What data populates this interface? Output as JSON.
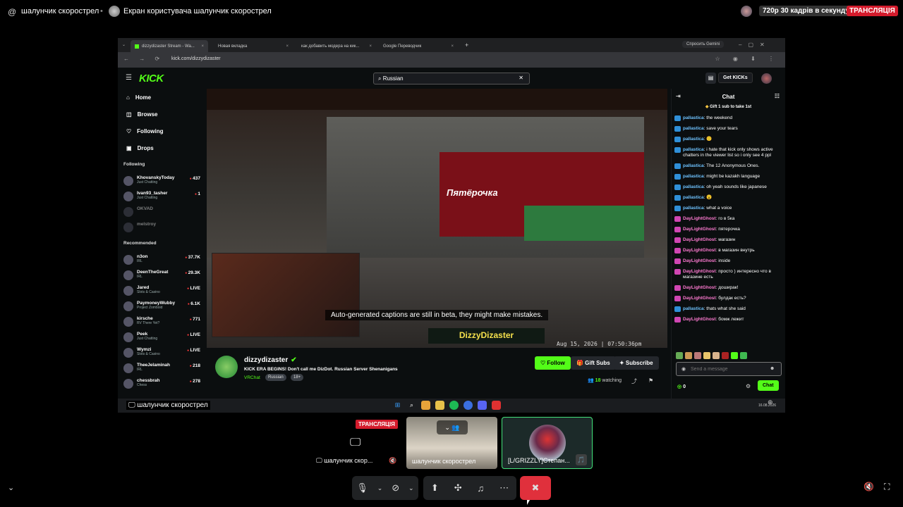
{
  "top": {
    "at_symbol": "@",
    "channel": "шалунчик скорострел",
    "screen_title": "Екран користувача шалунчик скорострел",
    "quality": "720p 30 кадрів в секунду",
    "live": "ТРАНСЛЯЦІЯ"
  },
  "browser": {
    "tabs": [
      {
        "label": "dizzydizaster Stream - Wa...",
        "close": "×"
      },
      {
        "label": "Новая вкладка",
        "close": "×"
      },
      {
        "label": "как добавить модера на кик...",
        "close": "×"
      },
      {
        "label": "Google Переводчик",
        "close": "×"
      }
    ],
    "new_tab": "+",
    "gemini": "Спросить Gemini",
    "url": "kick.com/dizzydizaster",
    "nav": "← → ⟳",
    "right_icons": "☆ ◉ ⬇ ⋮"
  },
  "kick": {
    "logo": "KICK",
    "search_value": "Russian",
    "search_clear": "✕",
    "get_kicks": "Get KICKs",
    "nav": [
      {
        "icon": "⌂",
        "label": "Home"
      },
      {
        "icon": "◫",
        "label": "Browse"
      },
      {
        "icon": "♡",
        "label": "Following"
      },
      {
        "icon": "▣",
        "label": "Drops"
      }
    ],
    "following_header": "Following",
    "following": [
      {
        "name": "KhovanskyToday",
        "cat": "Just Chatting",
        "viewers": "437",
        "off": false
      },
      {
        "name": "Ivan93_tasher",
        "cat": "Just Chatting",
        "viewers": "1",
        "off": false
      },
      {
        "name": "OKVAD",
        "cat": "",
        "viewers": "",
        "off": true
      },
      {
        "name": "melstroy",
        "cat": "",
        "viewers": "",
        "off": true
      }
    ],
    "recommended_header": "Recommended",
    "recommended": [
      {
        "name": "n3on",
        "cat": "IRL",
        "viewers": "37.7K"
      },
      {
        "name": "DeenTheGreat",
        "cat": "IRL",
        "viewers": "29.3K"
      },
      {
        "name": "Jared",
        "cat": "Slots & Casino",
        "viewers": "LIVE"
      },
      {
        "name": "PaymoneyWubby",
        "cat": "Project Zomboid",
        "viewers": "6.1K"
      },
      {
        "name": "kirsche",
        "cat": "RV There Yet?",
        "viewers": "771"
      },
      {
        "name": "Peek",
        "cat": "Just Chatting",
        "viewers": "LIVE"
      },
      {
        "name": "Wymzi",
        "cat": "Slots & Casino",
        "viewers": "LIVE"
      },
      {
        "name": "TheeJelaminah",
        "cat": "IRL",
        "viewers": "218"
      },
      {
        "name": "chessbrah",
        "cat": "Chess",
        "viewers": "278"
      }
    ],
    "video": {
      "store_sign": "Пятёрочка",
      "caption": "Auto-generated captions are still in beta, they might make mistakes.",
      "brand": "DizzyDizaster",
      "timestamp": "Aug 15, 2026 | 07:50:36pm"
    },
    "stream": {
      "channel": "dizzydizaster",
      "verified": "✔",
      "title": "KICK ERA BEGINS! Don't call me DizDot. Russian Server Shenanigans",
      "category": "VRChat",
      "tags": [
        "Russian",
        "18+"
      ],
      "follow": "♡ Follow",
      "gift": "🎁 Gift Subs",
      "subscribe": "✦ Subscribe",
      "watching_count": "18",
      "watching_label": "watching"
    },
    "chat": {
      "title": "Chat",
      "pinned": "Gift 1 sub to take 1st",
      "messages": [
        {
          "user": "pallastica",
          "text": "the weekend",
          "color": "#6fc3ff",
          "badge": "#2f8fd8"
        },
        {
          "user": "pallastica",
          "text": "save your tears",
          "color": "#6fc3ff",
          "badge": "#2f8fd8"
        },
        {
          "user": "pallastica",
          "text": "🙂",
          "color": "#6fc3ff",
          "badge": "#2f8fd8"
        },
        {
          "user": "pallastica",
          "text": "i hate that kick only shows active chatters in the viewer list so i only see 4 ppl",
          "color": "#6fc3ff",
          "badge": "#2f8fd8"
        },
        {
          "user": "pallastica",
          "text": "The 12 Anonymous Ones.",
          "color": "#6fc3ff",
          "badge": "#2f8fd8"
        },
        {
          "user": "pallastica",
          "text": "might be kazakh language",
          "color": "#6fc3ff",
          "badge": "#2f8fd8"
        },
        {
          "user": "pallastica",
          "text": "oh yeah sounds like japanese",
          "color": "#6fc3ff",
          "badge": "#2f8fd8"
        },
        {
          "user": "pallastica",
          "text": "😮",
          "color": "#6fc3ff",
          "badge": "#2f8fd8"
        },
        {
          "user": "pallastica",
          "text": "what a voice",
          "color": "#6fc3ff",
          "badge": "#2f8fd8"
        },
        {
          "user": "DayLightGhost",
          "text": "го в 5ка",
          "color": "#ff7bd2",
          "badge": "#d046b3"
        },
        {
          "user": "DayLightGhost",
          "text": "пятерочка",
          "color": "#ff7bd2",
          "badge": "#d046b3"
        },
        {
          "user": "DayLightGhost",
          "text": "магазин",
          "color": "#ff7bd2",
          "badge": "#d046b3"
        },
        {
          "user": "DayLightGhost",
          "text": "в магазин внутрь",
          "color": "#ff7bd2",
          "badge": "#d046b3"
        },
        {
          "user": "DayLightGhost",
          "text": "inside",
          "color": "#ff7bd2",
          "badge": "#d046b3"
        },
        {
          "user": "DayLightGhost",
          "text": "просто ) интересно что в магазине есть",
          "color": "#ff7bd2",
          "badge": "#d046b3"
        },
        {
          "user": "DayLightGhost",
          "text": "доширак!",
          "color": "#ff7bd2",
          "badge": "#d046b3"
        },
        {
          "user": "DayLightGhost",
          "text": "булдак есть?",
          "color": "#ff7bd2",
          "badge": "#d046b3"
        },
        {
          "user": "pallastica",
          "text": "thats what she said",
          "color": "#6fc3ff",
          "badge": "#2f8fd8"
        },
        {
          "user": "DayLightGhost",
          "text": "бомж лежит",
          "color": "#ff7bd2",
          "badge": "#d046b3"
        }
      ],
      "placeholder": "Send a message",
      "points": "0",
      "send": "Chat"
    }
  },
  "taskbar": {
    "label": "шалунчик скорострел",
    "date": "16.08.2026"
  },
  "tiles": {
    "tile1_live": "ТРАНСЛЯЦІЯ",
    "tile1_name": "шалунчик скор...",
    "tile2_name": "шалунчик скорострел",
    "tile3_name": "[L/GRIZZLY]Степан..."
  },
  "accent_colors": {
    "kick_green": "#53fc18",
    "live_red": "#d41b2c",
    "end_call": "#e0303c"
  }
}
